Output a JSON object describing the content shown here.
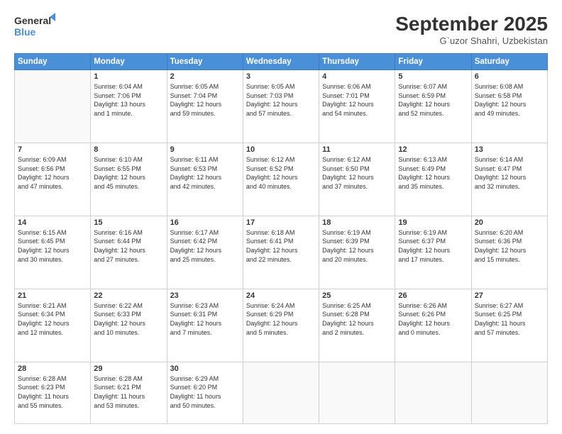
{
  "header": {
    "logo_general": "General",
    "logo_blue": "Blue",
    "title": "September 2025",
    "location": "G`uzor Shahri, Uzbekistan"
  },
  "weekdays": [
    "Sunday",
    "Monday",
    "Tuesday",
    "Wednesday",
    "Thursday",
    "Friday",
    "Saturday"
  ],
  "weeks": [
    [
      {
        "day": "",
        "text": ""
      },
      {
        "day": "1",
        "text": "Sunrise: 6:04 AM\nSunset: 7:06 PM\nDaylight: 13 hours\nand 1 minute."
      },
      {
        "day": "2",
        "text": "Sunrise: 6:05 AM\nSunset: 7:04 PM\nDaylight: 12 hours\nand 59 minutes."
      },
      {
        "day": "3",
        "text": "Sunrise: 6:05 AM\nSunset: 7:03 PM\nDaylight: 12 hours\nand 57 minutes."
      },
      {
        "day": "4",
        "text": "Sunrise: 6:06 AM\nSunset: 7:01 PM\nDaylight: 12 hours\nand 54 minutes."
      },
      {
        "day": "5",
        "text": "Sunrise: 6:07 AM\nSunset: 6:59 PM\nDaylight: 12 hours\nand 52 minutes."
      },
      {
        "day": "6",
        "text": "Sunrise: 6:08 AM\nSunset: 6:58 PM\nDaylight: 12 hours\nand 49 minutes."
      }
    ],
    [
      {
        "day": "7",
        "text": "Sunrise: 6:09 AM\nSunset: 6:56 PM\nDaylight: 12 hours\nand 47 minutes."
      },
      {
        "day": "8",
        "text": "Sunrise: 6:10 AM\nSunset: 6:55 PM\nDaylight: 12 hours\nand 45 minutes."
      },
      {
        "day": "9",
        "text": "Sunrise: 6:11 AM\nSunset: 6:53 PM\nDaylight: 12 hours\nand 42 minutes."
      },
      {
        "day": "10",
        "text": "Sunrise: 6:12 AM\nSunset: 6:52 PM\nDaylight: 12 hours\nand 40 minutes."
      },
      {
        "day": "11",
        "text": "Sunrise: 6:12 AM\nSunset: 6:50 PM\nDaylight: 12 hours\nand 37 minutes."
      },
      {
        "day": "12",
        "text": "Sunrise: 6:13 AM\nSunset: 6:49 PM\nDaylight: 12 hours\nand 35 minutes."
      },
      {
        "day": "13",
        "text": "Sunrise: 6:14 AM\nSunset: 6:47 PM\nDaylight: 12 hours\nand 32 minutes."
      }
    ],
    [
      {
        "day": "14",
        "text": "Sunrise: 6:15 AM\nSunset: 6:45 PM\nDaylight: 12 hours\nand 30 minutes."
      },
      {
        "day": "15",
        "text": "Sunrise: 6:16 AM\nSunset: 6:44 PM\nDaylight: 12 hours\nand 27 minutes."
      },
      {
        "day": "16",
        "text": "Sunrise: 6:17 AM\nSunset: 6:42 PM\nDaylight: 12 hours\nand 25 minutes."
      },
      {
        "day": "17",
        "text": "Sunrise: 6:18 AM\nSunset: 6:41 PM\nDaylight: 12 hours\nand 22 minutes."
      },
      {
        "day": "18",
        "text": "Sunrise: 6:19 AM\nSunset: 6:39 PM\nDaylight: 12 hours\nand 20 minutes."
      },
      {
        "day": "19",
        "text": "Sunrise: 6:19 AM\nSunset: 6:37 PM\nDaylight: 12 hours\nand 17 minutes."
      },
      {
        "day": "20",
        "text": "Sunrise: 6:20 AM\nSunset: 6:36 PM\nDaylight: 12 hours\nand 15 minutes."
      }
    ],
    [
      {
        "day": "21",
        "text": "Sunrise: 6:21 AM\nSunset: 6:34 PM\nDaylight: 12 hours\nand 12 minutes."
      },
      {
        "day": "22",
        "text": "Sunrise: 6:22 AM\nSunset: 6:33 PM\nDaylight: 12 hours\nand 10 minutes."
      },
      {
        "day": "23",
        "text": "Sunrise: 6:23 AM\nSunset: 6:31 PM\nDaylight: 12 hours\nand 7 minutes."
      },
      {
        "day": "24",
        "text": "Sunrise: 6:24 AM\nSunset: 6:29 PM\nDaylight: 12 hours\nand 5 minutes."
      },
      {
        "day": "25",
        "text": "Sunrise: 6:25 AM\nSunset: 6:28 PM\nDaylight: 12 hours\nand 2 minutes."
      },
      {
        "day": "26",
        "text": "Sunrise: 6:26 AM\nSunset: 6:26 PM\nDaylight: 12 hours\nand 0 minutes."
      },
      {
        "day": "27",
        "text": "Sunrise: 6:27 AM\nSunset: 6:25 PM\nDaylight: 11 hours\nand 57 minutes."
      }
    ],
    [
      {
        "day": "28",
        "text": "Sunrise: 6:28 AM\nSunset: 6:23 PM\nDaylight: 11 hours\nand 55 minutes."
      },
      {
        "day": "29",
        "text": "Sunrise: 6:28 AM\nSunset: 6:21 PM\nDaylight: 11 hours\nand 53 minutes."
      },
      {
        "day": "30",
        "text": "Sunrise: 6:29 AM\nSunset: 6:20 PM\nDaylight: 11 hours\nand 50 minutes."
      },
      {
        "day": "",
        "text": ""
      },
      {
        "day": "",
        "text": ""
      },
      {
        "day": "",
        "text": ""
      },
      {
        "day": "",
        "text": ""
      }
    ]
  ]
}
